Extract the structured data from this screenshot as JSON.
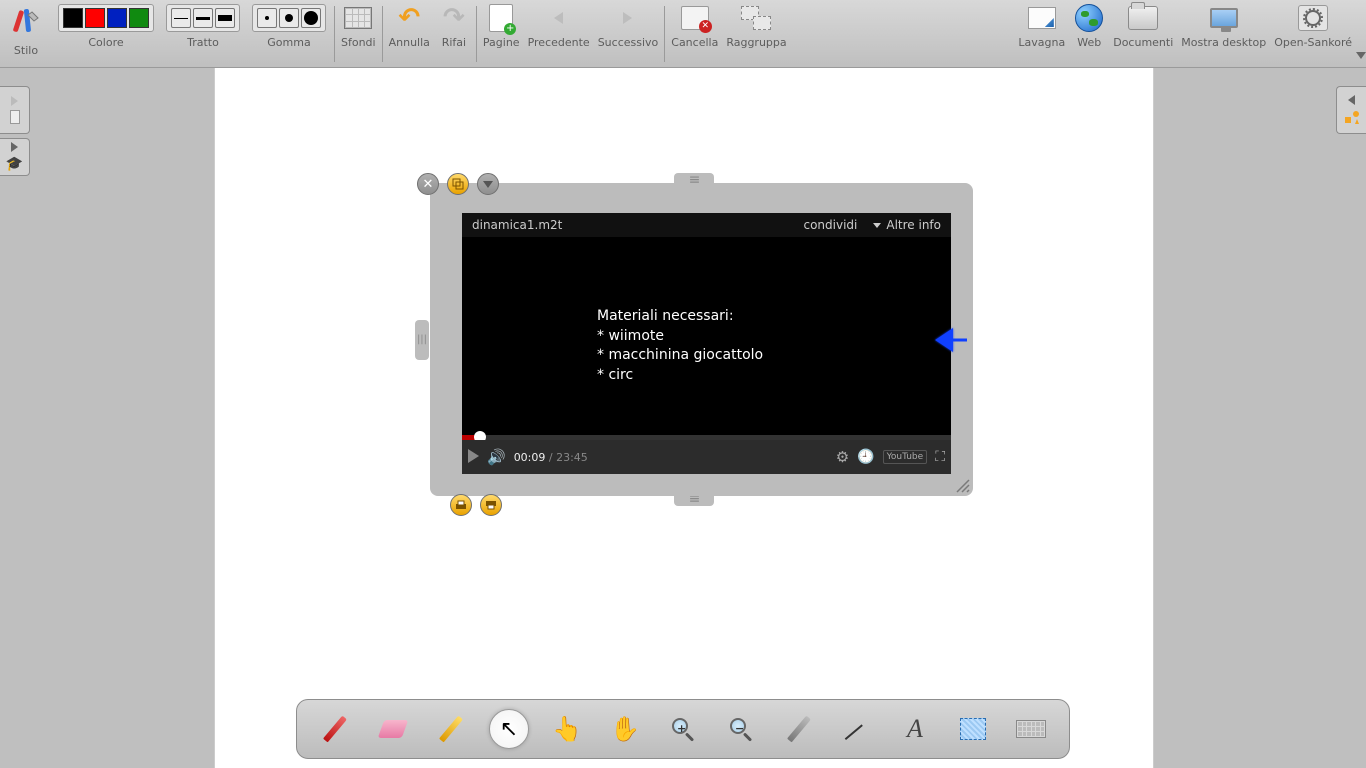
{
  "toolbar": {
    "stilo": "Stilo",
    "colore": "Colore",
    "tratto": "Tratto",
    "gomma": "Gomma",
    "sfondi": "Sfondi",
    "annulla": "Annulla",
    "rifai": "Rifai",
    "pagine": "Pagine",
    "precedente": "Precedente",
    "successivo": "Successivo",
    "cancella": "Cancella",
    "raggruppa": "Raggruppa",
    "lavagna": "Lavagna",
    "web": "Web",
    "documenti": "Documenti",
    "mostra_desktop": "Mostra desktop",
    "open_sankore": "Open-Sankoré",
    "colors": [
      "#000000",
      "#ff0000",
      "#0020c0",
      "#108a10"
    ]
  },
  "video": {
    "title": "dinamica1.m2t",
    "share": "condividi",
    "more_info": "Altre info",
    "body_heading": "Materiali necessari:",
    "body_items": [
      "* wiimote",
      "* macchinina giocattolo",
      "* circ"
    ],
    "current_time": "00:09",
    "total_time": "23:45",
    "youtube": "YouTube"
  }
}
